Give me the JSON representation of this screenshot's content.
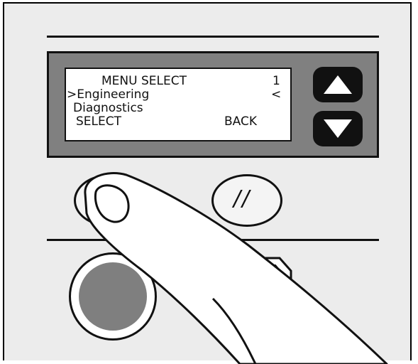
{
  "lcd": {
    "title": "MENU SELECT",
    "page_number": "1",
    "selected_item": ">Engineering",
    "cursor_marker": "<",
    "next_item": "Diagnostics",
    "left_softkey_label": "SELECT",
    "right_softkey_label": "BACK"
  },
  "buttons": {
    "up_arrow_icon": "triangle-up-icon",
    "down_arrow_icon": "triangle-down-icon",
    "right_softkey_mark": "//"
  },
  "colors": {
    "panel": "#808080",
    "lcd_background": "#ffffff",
    "button_black": "#111111",
    "large_button_gray": "#7f7f7f"
  }
}
